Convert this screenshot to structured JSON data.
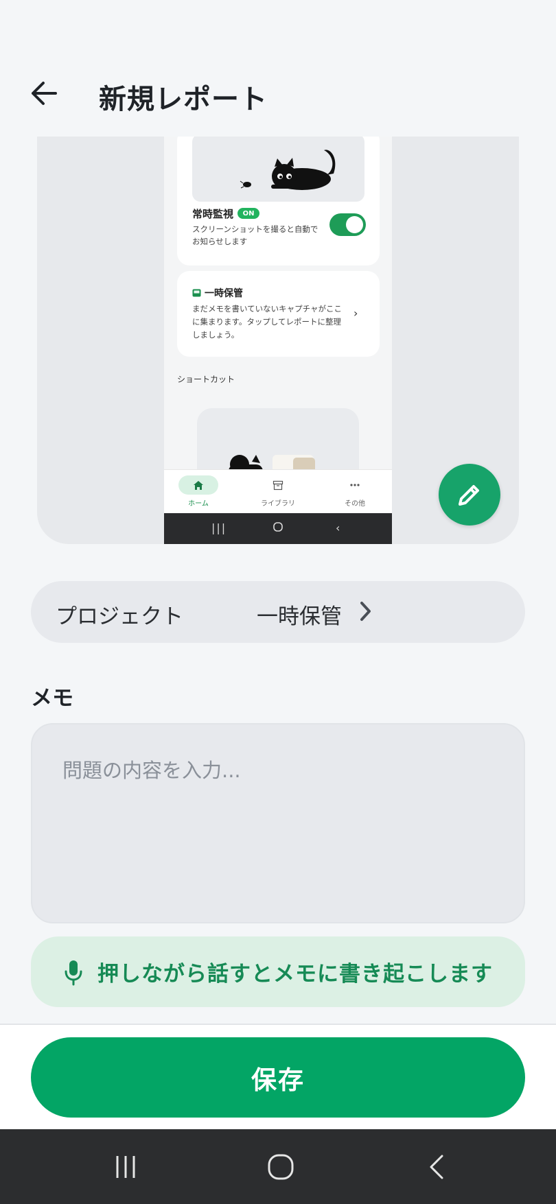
{
  "header": {
    "title": "新規レポート",
    "back_icon": "arrow-left-icon"
  },
  "preview": {
    "monitor": {
      "title": "常時監視",
      "badge": "ON",
      "description": "スクリーンショットを撮ると自動でお知らせします",
      "toggle_on": true
    },
    "temp_storage": {
      "title": "一時保管",
      "description": "まだメモを書いていないキャプチャがここに集まります。タップしてレポートに整理しましょう。"
    },
    "shortcut_label": "ショートカット",
    "nav": [
      {
        "label": "ホーム",
        "icon": "home-icon",
        "active": true
      },
      {
        "label": "ライブラリ",
        "icon": "archive-icon",
        "active": false
      },
      {
        "label": "その他",
        "icon": "more-icon",
        "active": false
      }
    ]
  },
  "fab": {
    "icon": "pencil-icon"
  },
  "project": {
    "label": "プロジェクト",
    "value": "一時保管"
  },
  "memo": {
    "label": "メモ",
    "placeholder": "問題の内容を入力..."
  },
  "voice": {
    "label": "押しながら話すとメモに書き起こします",
    "icon": "microphone-icon"
  },
  "save": {
    "label": "保存"
  },
  "colors": {
    "accent": "#03a565",
    "accent_light": "#dcf0e4",
    "toggle_green": "#1e9c57"
  }
}
